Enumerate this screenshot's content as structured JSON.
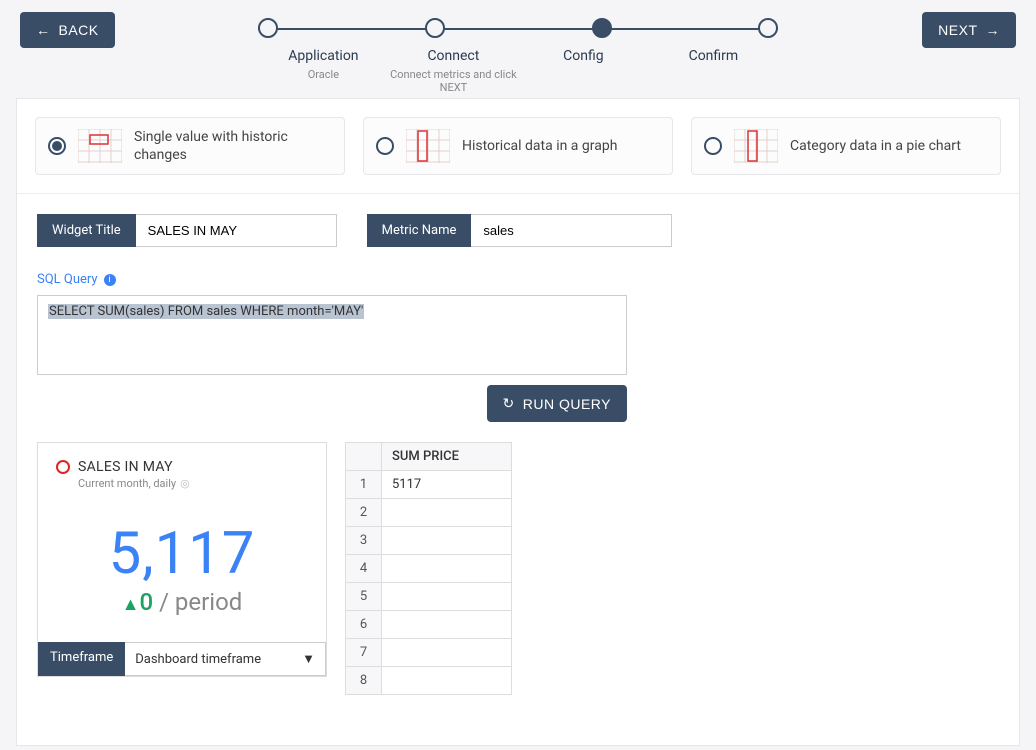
{
  "header": {
    "back_label": "BACK",
    "next_label": "NEXT"
  },
  "stepper": {
    "steps": [
      "Application",
      "Connect",
      "Config",
      "Confirm"
    ],
    "sub": [
      "Oracle",
      "Connect metrics and click NEXT",
      "",
      ""
    ]
  },
  "chart_types": {
    "single": "Single value with historic changes",
    "graph": "Historical data in a graph",
    "pie": "Category data in a pie chart"
  },
  "form": {
    "widget_title_label": "Widget Title",
    "widget_title_value": "SALES IN MAY",
    "metric_name_label": "Metric Name",
    "metric_name_value": "sales"
  },
  "sql": {
    "label": "SQL Query",
    "text": "SELECT SUM(sales) FROM sales WHERE month='MAY'",
    "run_label": "RUN QUERY"
  },
  "preview": {
    "title": "SALES IN MAY",
    "subtitle": "Current month, daily",
    "value": "5,117",
    "delta_value": "0",
    "delta_suffix": " / period",
    "timeframe_label": "Timeframe",
    "timeframe_value": "Dashboard timeframe"
  },
  "results": {
    "header": "SUM PRICE",
    "rows": [
      {
        "n": "1",
        "v": "5117"
      },
      {
        "n": "2",
        "v": ""
      },
      {
        "n": "3",
        "v": ""
      },
      {
        "n": "4",
        "v": ""
      },
      {
        "n": "5",
        "v": ""
      },
      {
        "n": "6",
        "v": ""
      },
      {
        "n": "7",
        "v": ""
      },
      {
        "n": "8",
        "v": ""
      }
    ]
  }
}
